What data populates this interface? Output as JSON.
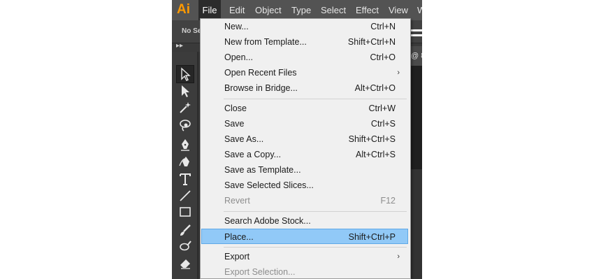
{
  "app": {
    "logo_text": "Ai",
    "accent": "#ff9a00",
    "menubar": [
      "File",
      "Edit",
      "Object",
      "Type",
      "Select",
      "Effect",
      "View",
      "W"
    ],
    "control_bar_text": "No Se",
    "doc_tab_text": "@ 8",
    "panel_collapse_glyph": "▸▸"
  },
  "tools": [
    {
      "name": "selection-tool-icon",
      "active": true
    },
    {
      "name": "direct-selection-tool-icon"
    },
    {
      "name": "magic-wand-tool-icon"
    },
    {
      "name": "lasso-tool-icon"
    },
    {
      "name": "pen-tool-icon"
    },
    {
      "name": "curvature-tool-icon"
    },
    {
      "name": "type-tool-icon"
    },
    {
      "name": "line-segment-tool-icon"
    },
    {
      "name": "rectangle-tool-icon"
    },
    {
      "name": "paintbrush-tool-icon"
    },
    {
      "name": "shaper-tool-icon"
    },
    {
      "name": "eraser-tool-icon"
    }
  ],
  "file_menu": {
    "highlight_color": "#91c9f7",
    "groups": [
      [
        {
          "label": "New...",
          "shortcut": "Ctrl+N"
        },
        {
          "label": "New from Template...",
          "shortcut": "Shift+Ctrl+N"
        },
        {
          "label": "Open...",
          "shortcut": "Ctrl+O"
        },
        {
          "label": "Open Recent Files",
          "shortcut": "",
          "submenu": true
        },
        {
          "label": "Browse in Bridge...",
          "shortcut": "Alt+Ctrl+O"
        }
      ],
      [
        {
          "label": "Close",
          "shortcut": "Ctrl+W"
        },
        {
          "label": "Save",
          "shortcut": "Ctrl+S"
        },
        {
          "label": "Save As...",
          "shortcut": "Shift+Ctrl+S"
        },
        {
          "label": "Save a Copy...",
          "shortcut": "Alt+Ctrl+S"
        },
        {
          "label": "Save as Template...",
          "shortcut": ""
        },
        {
          "label": "Save Selected Slices...",
          "shortcut": ""
        },
        {
          "label": "Revert",
          "shortcut": "F12",
          "disabled": true
        }
      ],
      [
        {
          "label": "Search Adobe Stock...",
          "shortcut": ""
        },
        {
          "label": "Place...",
          "shortcut": "Shift+Ctrl+P",
          "highlighted": true
        }
      ],
      [
        {
          "label": "Export",
          "shortcut": "",
          "submenu": true
        },
        {
          "label": "Export Selection...",
          "shortcut": "",
          "disabled": true
        }
      ]
    ]
  }
}
